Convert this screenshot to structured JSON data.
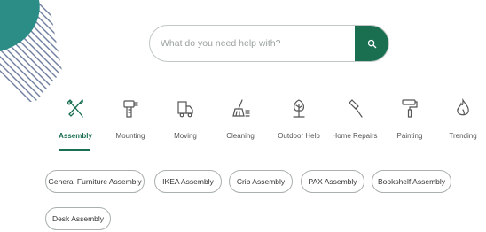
{
  "theme": {
    "accent": "#1a6f51",
    "deco_teal": "#2c8c86",
    "deco_stripe": "#6f7fa0"
  },
  "search": {
    "placeholder": "What do you need help with?",
    "value": "",
    "button_icon": "search-icon"
  },
  "categories": [
    {
      "label": "Assembly",
      "icon": "tools-icon",
      "active": true
    },
    {
      "label": "Mounting",
      "icon": "drill-icon",
      "active": false
    },
    {
      "label": "Moving",
      "icon": "truck-icon",
      "active": false
    },
    {
      "label": "Cleaning",
      "icon": "broom-icon",
      "active": false
    },
    {
      "label": "Outdoor Help",
      "icon": "tree-icon",
      "active": false
    },
    {
      "label": "Home Repairs",
      "icon": "hammer-icon",
      "active": false
    },
    {
      "label": "Painting",
      "icon": "paint-roller-icon",
      "active": false
    },
    {
      "label": "Trending",
      "icon": "flame-icon",
      "active": false
    }
  ],
  "chips": [
    "General Furniture Assembly",
    "IKEA Assembly",
    "Crib Assembly",
    "PAX Assembly",
    "Bookshelf Assembly",
    "Desk Assembly"
  ]
}
